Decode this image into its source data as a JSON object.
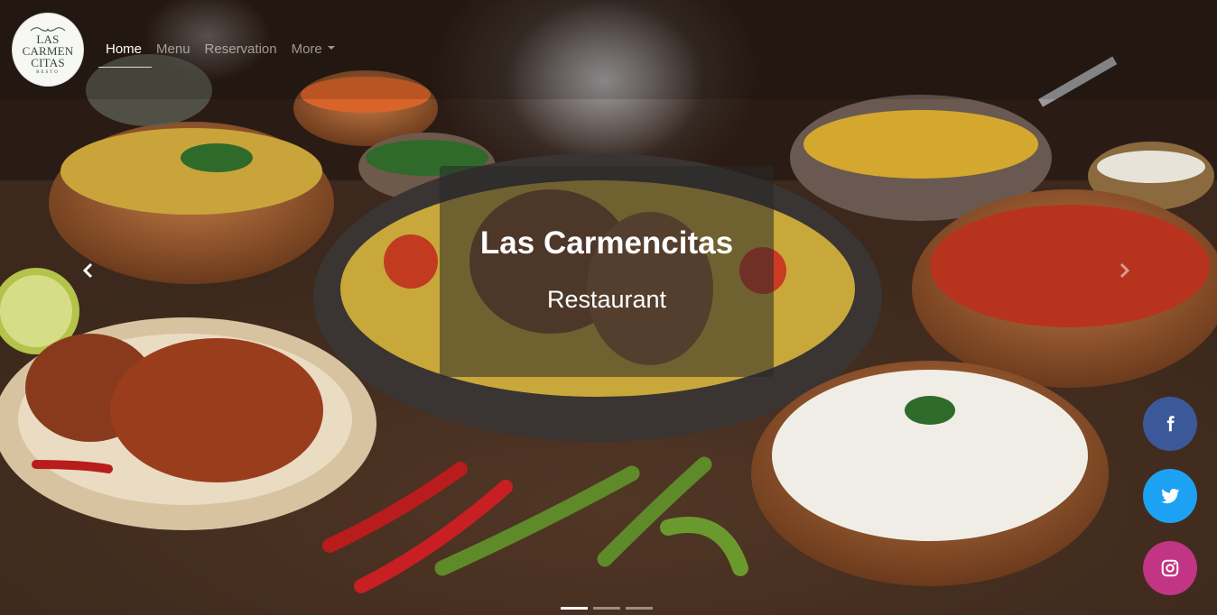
{
  "logo": {
    "lines": [
      "LAS",
      "CARMEN",
      "CITAS"
    ],
    "sub": "RESTO"
  },
  "nav": {
    "items": [
      {
        "label": "Home",
        "active": true
      },
      {
        "label": "Menu",
        "active": false
      },
      {
        "label": "Reservation",
        "active": false
      },
      {
        "label": "More",
        "active": false,
        "dropdown": true
      }
    ]
  },
  "carousel": {
    "title": "Las Carmencitas",
    "subtitle": "Restaurant",
    "prev_icon": "chevron-left-icon",
    "next_icon": "chevron-right-icon",
    "slide_count": 3,
    "active_slide": 1
  },
  "social": {
    "items": [
      {
        "name": "facebook",
        "icon": "facebook-icon",
        "color": "#3b5998"
      },
      {
        "name": "twitter",
        "icon": "twitter-icon",
        "color": "#1da1f2"
      },
      {
        "name": "instagram",
        "icon": "instagram-icon",
        "color": "#c13584"
      }
    ]
  }
}
